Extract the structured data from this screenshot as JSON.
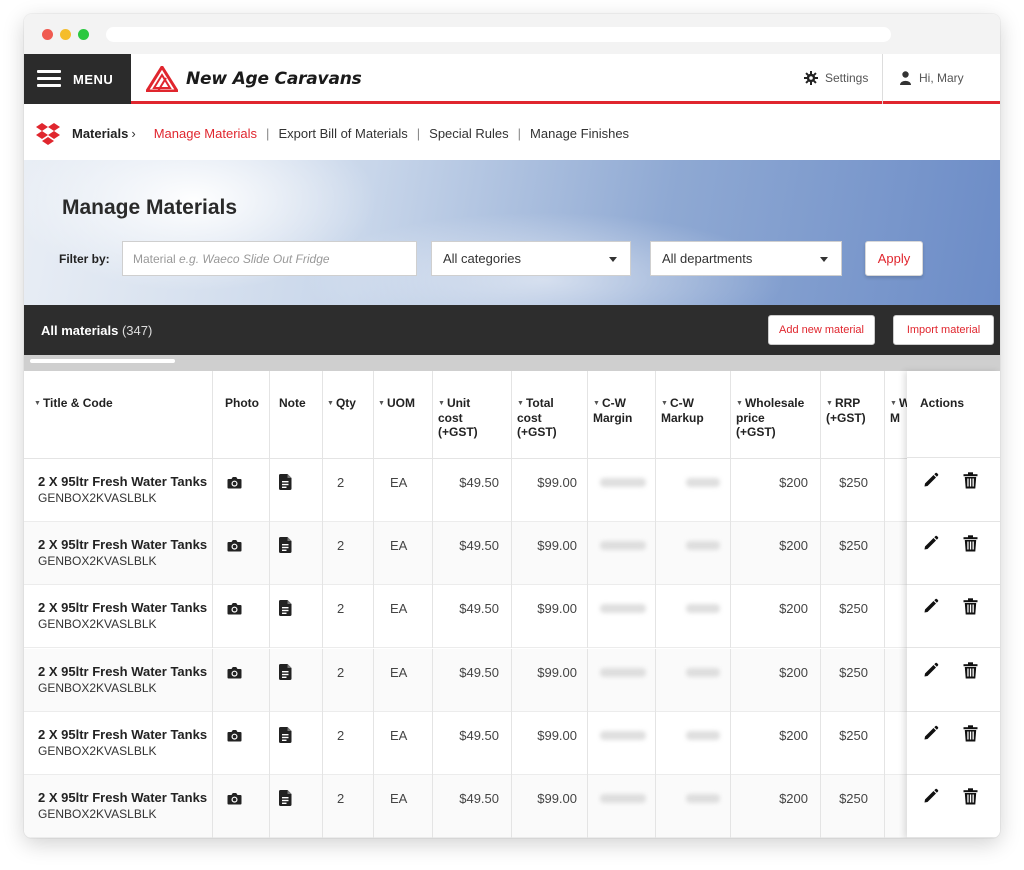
{
  "nav": {
    "menu_label": "MENU",
    "brand": "New Age Caravans",
    "settings_label": "Settings",
    "user_label": "Hi, Mary"
  },
  "breadcrumb": {
    "root": "Materials",
    "separator": "›",
    "active": "Manage Materials",
    "links": [
      "Export Bill of Materials",
      "Special Rules",
      "Manage Finishes"
    ],
    "divider": "|"
  },
  "hero": {
    "title": "Manage Materials",
    "filter_label": "Filter by:",
    "filter_placeholder_prefix": "Material",
    "filter_placeholder_example": "e.g. Waeco Slide Out Fridge",
    "category_select": "All categories",
    "department_select": "All departments",
    "apply_label": "Apply"
  },
  "bar": {
    "title": "All materials",
    "count": "(347)",
    "add_label": "Add new material",
    "import_label": "Import material"
  },
  "table": {
    "columns": [
      {
        "label": "Title & Code",
        "sortable": true
      },
      {
        "label": "Photo",
        "sortable": false
      },
      {
        "label": "Note",
        "sortable": false
      },
      {
        "label": "Qty",
        "sortable": true
      },
      {
        "label": "UOM",
        "sortable": true
      },
      {
        "label": "Unit cost (+GST)",
        "sortable": true
      },
      {
        "label": "Total cost (+GST)",
        "sortable": true
      },
      {
        "label": "C-W Margin",
        "sortable": true
      },
      {
        "label": "C-W Markup",
        "sortable": true
      },
      {
        "label": "Wholesale price (+GST)",
        "sortable": true
      },
      {
        "label": "RRP (+GST)",
        "sortable": true
      },
      {
        "label": "W M",
        "sortable": true
      }
    ],
    "actions_header": "Actions",
    "rows": [
      {
        "title": "2 X 95ltr Fresh Water Tanks",
        "code": "GENBOX2KVASLBLK",
        "qty": "2",
        "uom": "EA",
        "unit_cost": "$49.50",
        "total_cost": "$99.00",
        "wholesale": "$200",
        "rrp": "$250"
      },
      {
        "title": "2 X 95ltr Fresh Water Tanks",
        "code": "GENBOX2KVASLBLK",
        "qty": "2",
        "uom": "EA",
        "unit_cost": "$49.50",
        "total_cost": "$99.00",
        "wholesale": "$200",
        "rrp": "$250"
      },
      {
        "title": "2 X 95ltr Fresh Water Tanks",
        "code": "GENBOX2KVASLBLK",
        "qty": "2",
        "uom": "EA",
        "unit_cost": "$49.50",
        "total_cost": "$99.00",
        "wholesale": "$200",
        "rrp": "$250"
      },
      {
        "title": "2 X 95ltr Fresh Water Tanks",
        "code": "GENBOX2KVASLBLK",
        "qty": "2",
        "uom": "EA",
        "unit_cost": "$49.50",
        "total_cost": "$99.00",
        "wholesale": "$200",
        "rrp": "$250"
      },
      {
        "title": "2 X 95ltr Fresh Water Tanks",
        "code": "GENBOX2KVASLBLK",
        "qty": "2",
        "uom": "EA",
        "unit_cost": "$49.50",
        "total_cost": "$99.00",
        "wholesale": "$200",
        "rrp": "$250"
      },
      {
        "title": "2 X 95ltr Fresh Water Tanks",
        "code": "GENBOX2KVASLBLK",
        "qty": "2",
        "uom": "EA",
        "unit_cost": "$49.50",
        "total_cost": "$99.00",
        "wholesale": "$200",
        "rrp": "$250"
      }
    ]
  },
  "colors": {
    "accent": "#e0262e",
    "dark": "#2d2d2d"
  },
  "icons": [
    "hamburger-icon",
    "brand-logo",
    "gear-icon",
    "user-icon",
    "materials-logo",
    "camera-icon",
    "note-icon",
    "pencil-icon",
    "trash-icon"
  ]
}
